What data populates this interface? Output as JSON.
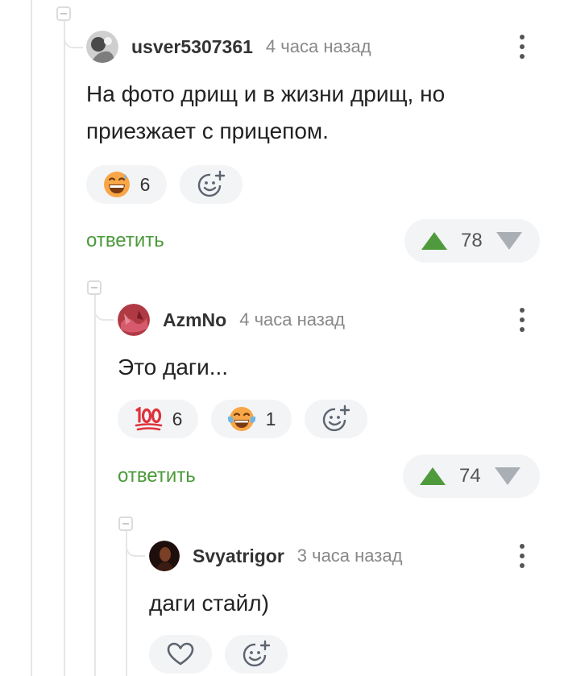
{
  "comments": [
    {
      "username": "usver5307361",
      "time": "4 часа назад",
      "text": "На фото дрищ и в жизни дрищ, но приезжает с прицепом.",
      "reactions": [
        {
          "icon": "grinning-sweat-emoji",
          "count": "6"
        }
      ],
      "reply_label": "ответить",
      "rating": "78"
    },
    {
      "username": "AzmNo",
      "time": "4 часа назад",
      "text": "Это даги...",
      "reactions": [
        {
          "icon": "hundred-points-emoji",
          "count": "6"
        },
        {
          "icon": "tears-of-joy-emoji",
          "count": "1"
        }
      ],
      "reply_label": "ответить",
      "rating": "74"
    },
    {
      "username": "Svyatrigor",
      "time": "3 часа назад",
      "text": "даги стайл)",
      "reactions": [
        {
          "icon": "heart-icon"
        }
      ]
    }
  ],
  "colors": {
    "accent": "#4b9a3a",
    "upvote": "#4f9a3c",
    "downvote": "#a9afb5",
    "pill_bg": "#f3f4f6"
  }
}
